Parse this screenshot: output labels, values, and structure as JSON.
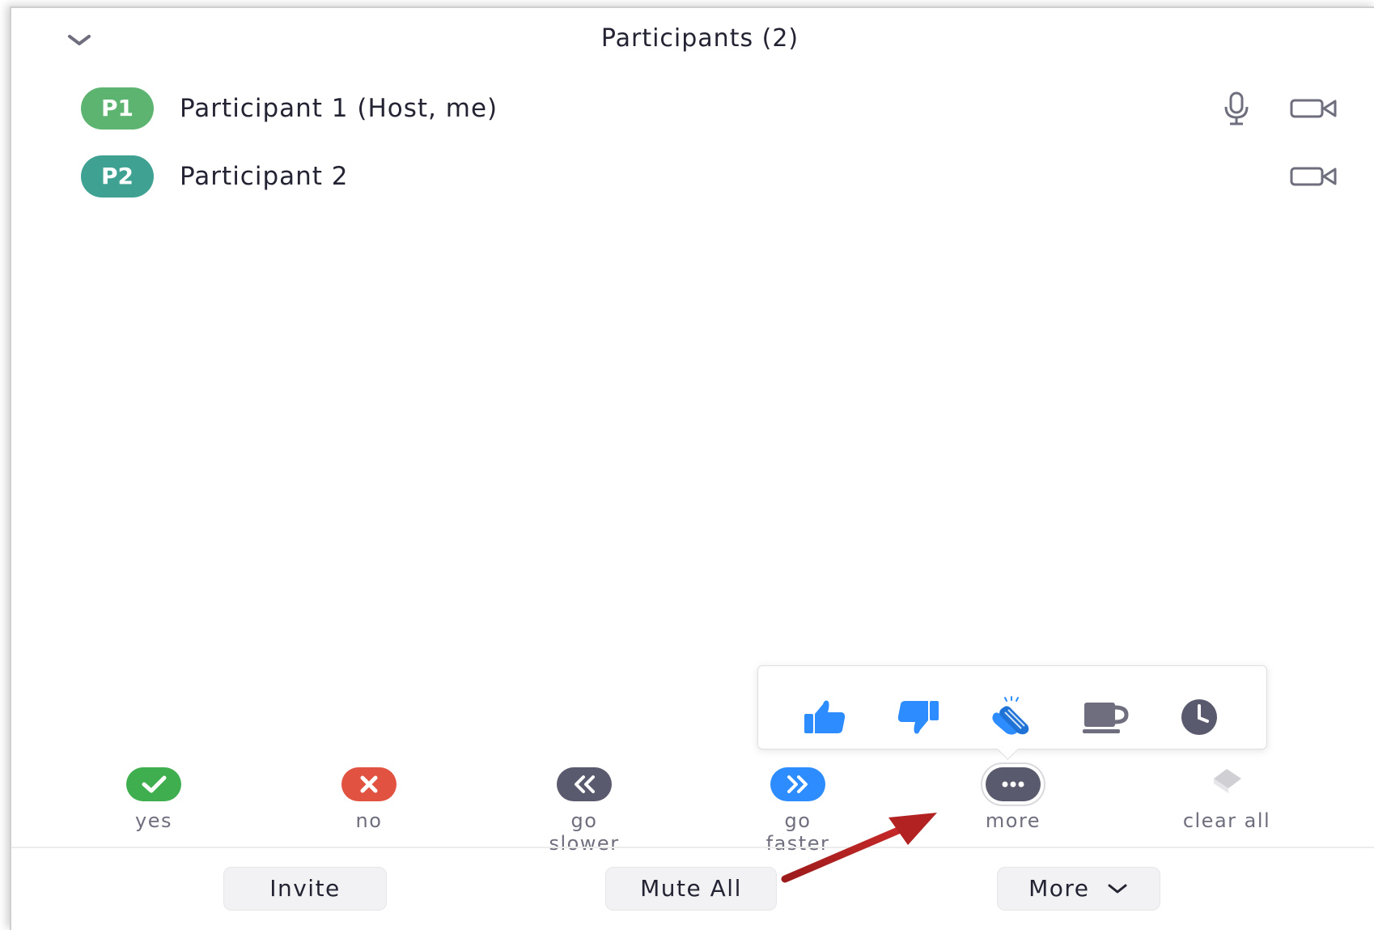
{
  "header": {
    "title": "Participants (2)",
    "collapse_icon": "chevron-down-icon"
  },
  "participants": [
    {
      "initials": "P1",
      "name": "Participant 1 (Host, me)",
      "color": "#5cb470",
      "icons": [
        "microphone-icon",
        "video-camera-icon"
      ]
    },
    {
      "initials": "P2",
      "name": "Participant 2",
      "color": "#3fa192",
      "icons": [
        "video-camera-icon"
      ]
    }
  ],
  "reactions_popover": {
    "items": [
      {
        "name": "thumbs-up-icon",
        "color": "#2d8cff"
      },
      {
        "name": "thumbs-down-icon",
        "color": "#2d8cff"
      },
      {
        "name": "clapping-hands-icon",
        "color": "#2d8cff"
      },
      {
        "name": "coffee-cup-icon",
        "color": "#6e6e7e"
      },
      {
        "name": "clock-icon",
        "color": "#5a5a6e"
      }
    ]
  },
  "feedback": [
    {
      "label": "yes",
      "color": "#3fae4f"
    },
    {
      "label": "no",
      "color": "#e15241"
    },
    {
      "label": "go slower",
      "color": "#5a5a6e"
    },
    {
      "label": "go faster",
      "color": "#2d8cff"
    },
    {
      "label": "more",
      "color": "#5a5a6e"
    },
    {
      "label": "clear all",
      "color": "#cfcfd4"
    }
  ],
  "footer": {
    "invite": "Invite",
    "mute_all": "Mute All",
    "more": "More"
  },
  "annotation": {
    "arrow_color": "#b22222"
  }
}
